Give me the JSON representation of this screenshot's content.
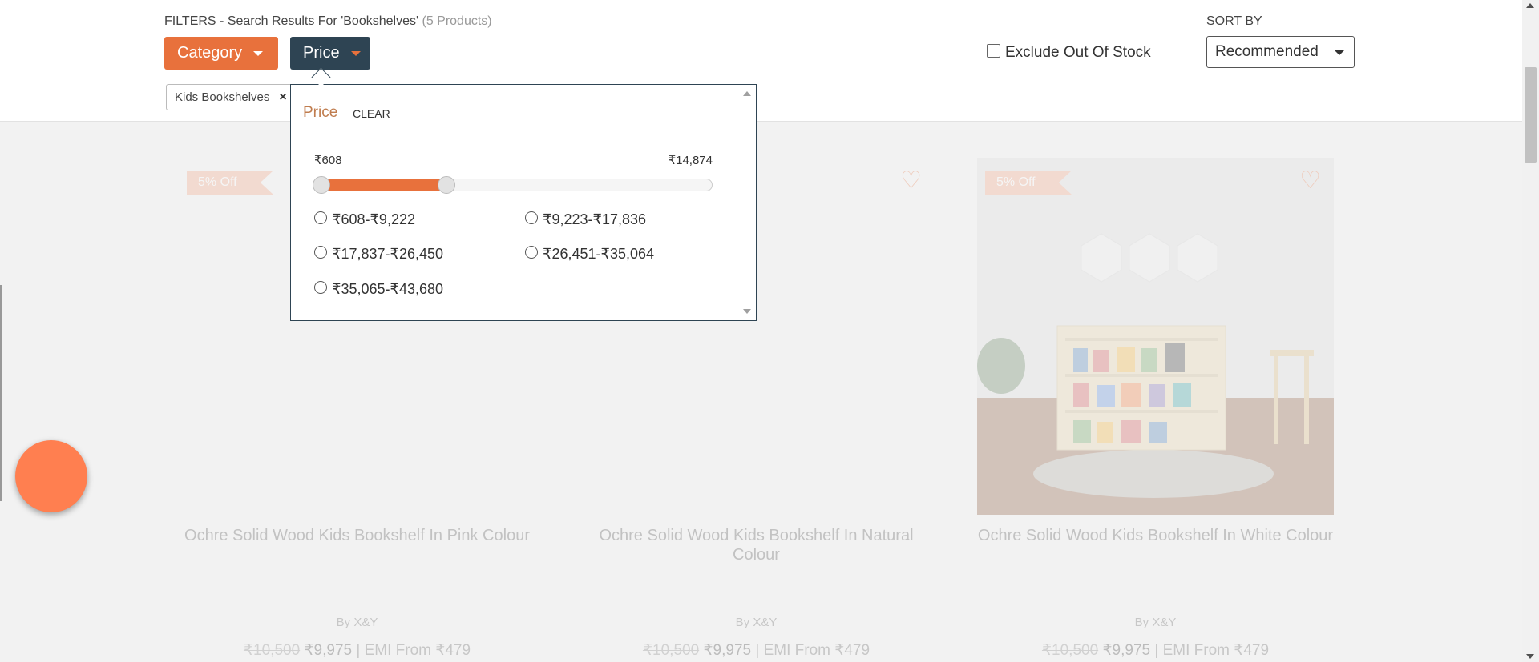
{
  "header": {
    "filters_prefix": "FILTERS - Search Results For 'Bookshelves'",
    "product_count": "(5 Products)"
  },
  "filter_buttons": {
    "category_label": "Category",
    "price_label": "Price"
  },
  "active_chips": [
    {
      "label": "Kids Bookshelves",
      "remove_icon": "×"
    }
  ],
  "exclude_out_of_stock": {
    "label": "Exclude Out Of Stock",
    "checked": false
  },
  "sort": {
    "label": "SORT BY",
    "selected": "Recommended"
  },
  "price_panel": {
    "title": "Price",
    "clear_label": "CLEAR",
    "range_min_label": "₹608",
    "range_max_label": "₹14,874",
    "slider": {
      "min": 608,
      "max": 43680,
      "low": 608,
      "high": 14874
    },
    "options": [
      {
        "label": "₹608-₹9,222",
        "selected": false
      },
      {
        "label": "₹9,223-₹17,836",
        "selected": false
      },
      {
        "label": "₹17,837-₹26,450",
        "selected": false
      },
      {
        "label": "₹26,451-₹35,064",
        "selected": false
      },
      {
        "label": "₹35,065-₹43,680",
        "selected": false
      }
    ]
  },
  "products": [
    {
      "badge": "5% Off",
      "title": "Ochre Solid Wood Kids Bookshelf In Pink Colour",
      "brand": "By X&Y",
      "mrp": "₹10,500",
      "price": "₹9,975",
      "emi": "| EMI From ₹479"
    },
    {
      "badge": "",
      "title": "Ochre Solid Wood Kids Bookshelf In Natural Colour",
      "brand": "By X&Y",
      "mrp": "₹10,500",
      "price": "₹9,975",
      "emi": "| EMI From ₹479"
    },
    {
      "badge": "5% Off",
      "title": "Ochre Solid Wood Kids Bookshelf In White Colour",
      "brand": "By X&Y",
      "mrp": "₹10,500",
      "price": "₹9,975",
      "emi": "| EMI From ₹479"
    }
  ],
  "icons": {
    "heart": "heart-icon",
    "caret": "caret-down-icon",
    "close": "close-icon",
    "chat": "chat-fab-icon"
  },
  "colors": {
    "accent": "#e8713c",
    "dark_button": "#2e4453",
    "fab": "#ff7f50"
  }
}
